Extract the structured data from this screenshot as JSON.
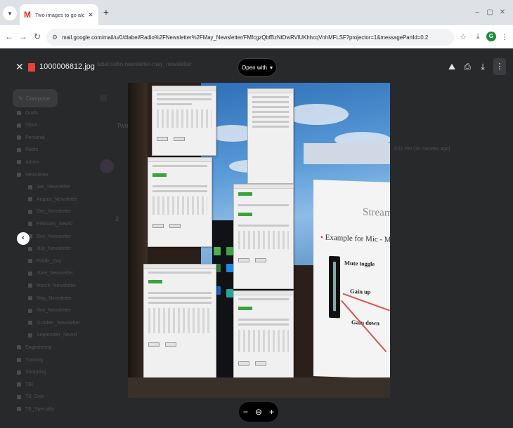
{
  "browser": {
    "tab_title": "Two images to go along with t",
    "url": "mail.google.com/mail/u/0/#label/Radio%2FNewsletter%2FMay_Newsletter/FMfcgzQbfBzNtDwRVlUKhhcqVnhMFLSF?projector=1&messagePartId=0.2",
    "profile_initial": "G"
  },
  "viewer": {
    "filename": "1000006812.jpg",
    "open_with_label": "Open with",
    "search_hint": "label:radio-newsletter-may_newsletter"
  },
  "background": {
    "compose_label": "Compose",
    "sidebar_labels": [
      "Drafts",
      "Inbox",
      "Personal",
      "Radio",
      "Admin",
      "Newsletter",
      "Jan_Newsletter",
      "August_Newsletter",
      "Dec_Newsletter",
      "February_Newsl",
      "Dec_Newsletter",
      "July_Newsletter",
      "Fiddle_Day",
      "June_Newsletter",
      "March_Newsletter",
      "May_Newsletter",
      "Nov_Newsletter",
      "October_Newsletter",
      "September_Newsl",
      "Engineering",
      "Training",
      "Shopping",
      "TBI",
      "TB_Disk",
      "TB_Specialty"
    ],
    "subject_fragment": "Two",
    "time_fragment": "3:21 PM (30 minutes ago)"
  },
  "photo_text": {
    "slide_title": "Stream D",
    "bullet": "Example for Mic - Mute",
    "label_mute": "Mute toggle",
    "label_gain_up": "Gain up",
    "label_gain_down": "Gain down"
  },
  "zoom": {
    "minus": "−",
    "reset": "⊖",
    "plus": "+"
  },
  "colors": {
    "viewer_bg": "#28292b",
    "accent_red": "#ea4335",
    "profile_green": "#1e8e3e"
  }
}
